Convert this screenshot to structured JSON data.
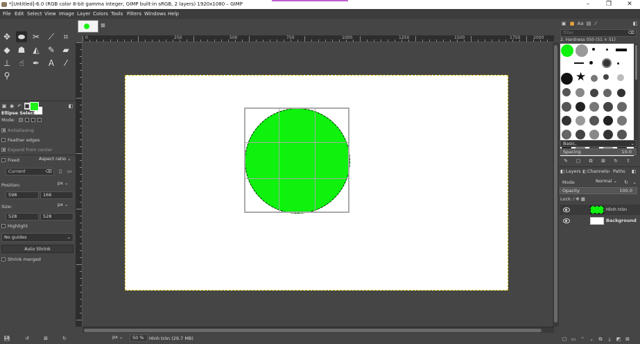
{
  "window": {
    "title": "*[Untitled]-6.0 (RGB color 8-bit gamma integer, GIMP built-in sRGB, 2 layers) 1920x1080 – GIMP",
    "minimize": "–",
    "maximize": "❐",
    "close": "✕"
  },
  "menu": [
    "File",
    "Edit",
    "Select",
    "View",
    "Image",
    "Layer",
    "Colors",
    "Tools",
    "Filters",
    "Windows",
    "Help"
  ],
  "tool_options": {
    "title": "Ellipse Select",
    "mode_label": "Mode:",
    "antialiasing": "Antialiasing",
    "feather_edges": "Feather edges",
    "expand_from_center": "Expand from center",
    "fixed": "Fixed",
    "fixed_mode": "Aspect ratio",
    "current": "Current",
    "position_label": "Position:",
    "position_unit": "px",
    "pos_x": "598",
    "pos_y": "166",
    "size_label": "Size:",
    "size_unit": "px",
    "size_w": "528",
    "size_h": "528",
    "highlight": "Highlight",
    "guides": "No guides",
    "auto_shrink": "Auto Shrink",
    "shrink_merged": "Shrink merged"
  },
  "ruler": {
    "h_ticks": [
      "0",
      "250",
      "500",
      "750",
      "1000",
      "1250",
      "1500",
      "1750",
      "2000"
    ]
  },
  "status": {
    "unit": "px",
    "zoom": "50 %",
    "info": "Hình tròn (29.7 MB)"
  },
  "brushes": {
    "filter_placeholder": "filter",
    "current_brush": "2. Hardness 050 (51 × 51)",
    "tag": "Basic,",
    "spacing_label": "Spacing",
    "spacing_value": "10.0"
  },
  "layers": {
    "tabs": [
      "Layers",
      "Channels",
      "Paths"
    ],
    "mode_label": "Mode",
    "mode_value": "Normal",
    "opacity_label": "Opacity",
    "opacity_value": "100.0",
    "lock_label": "Lock:",
    "items": [
      {
        "name": "Hình tròn",
        "bold": false
      },
      {
        "name": "Background",
        "bold": true
      }
    ]
  },
  "colors": {
    "foreground": "#1ef019",
    "background": "#ffffff",
    "circle": "#0ef20e"
  }
}
